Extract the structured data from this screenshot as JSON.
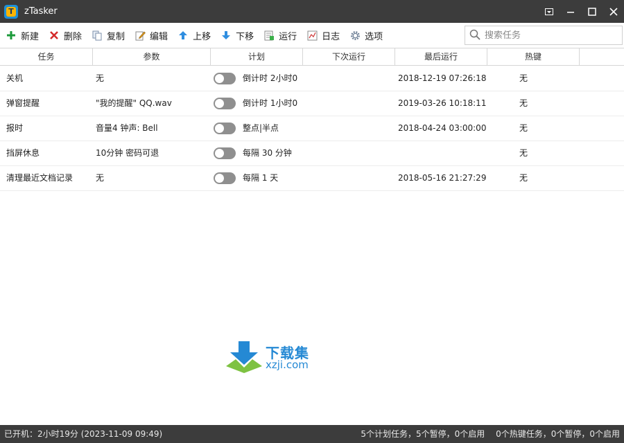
{
  "app": {
    "title": "zTasker",
    "logo_letter": "T"
  },
  "toolbar": {
    "buttons": [
      {
        "label": "新建",
        "icon": "plus-icon"
      },
      {
        "label": "删除",
        "icon": "x-icon"
      },
      {
        "label": "复制",
        "icon": "copy-icon"
      },
      {
        "label": "编辑",
        "icon": "edit-icon"
      },
      {
        "label": "上移",
        "icon": "arrow-up-icon"
      },
      {
        "label": "下移",
        "icon": "arrow-down-icon"
      },
      {
        "label": "运行",
        "icon": "run-icon"
      },
      {
        "label": "日志",
        "icon": "log-icon"
      },
      {
        "label": "选项",
        "icon": "gear-icon"
      }
    ],
    "search_placeholder": "搜索任务"
  },
  "table": {
    "columns": [
      "任务",
      "参数",
      "计划",
      "下次运行",
      "最后运行",
      "热键"
    ],
    "rows": [
      {
        "name": "关机",
        "param": "无",
        "enabled": false,
        "plan": "倒计时 2小时0",
        "next": "",
        "last": "2018-12-19 07:26:18",
        "hotkey": "无"
      },
      {
        "name": "弹窗提醒",
        "param": "\"我的提醒\" QQ.wav",
        "enabled": false,
        "plan": "倒计时 1小时0",
        "next": "",
        "last": "2019-03-26 10:18:11",
        "hotkey": "无"
      },
      {
        "name": "报时",
        "param": "音量4 钟声: Bell",
        "enabled": false,
        "plan": "整点|半点",
        "next": "",
        "last": "2018-04-24 03:00:00",
        "hotkey": "无"
      },
      {
        "name": "挡屏休息",
        "param": "10分钟 密码可退",
        "enabled": false,
        "plan": "每隔 30 分钟",
        "next": "",
        "last": "",
        "hotkey": "无"
      },
      {
        "name": "清理最近文档记录",
        "param": "无",
        "enabled": false,
        "plan": "每隔 1 天",
        "next": "",
        "last": "2018-05-16 21:27:29",
        "hotkey": "无"
      }
    ]
  },
  "watermark": {
    "cn": "下载集",
    "en": "xzji.com"
  },
  "statusbar": {
    "uptime": "已开机：2小时19分 (2023-11-09 09:49)",
    "scheduled": "5个计划任务，5个暂停，0个启用",
    "hotkeys": "0个热键任务，0个暂停，0个启用"
  },
  "colors": {
    "titlebar": "#3c3c3c",
    "toggle_off": "#8f8f8f",
    "accent": "#2589d4"
  }
}
